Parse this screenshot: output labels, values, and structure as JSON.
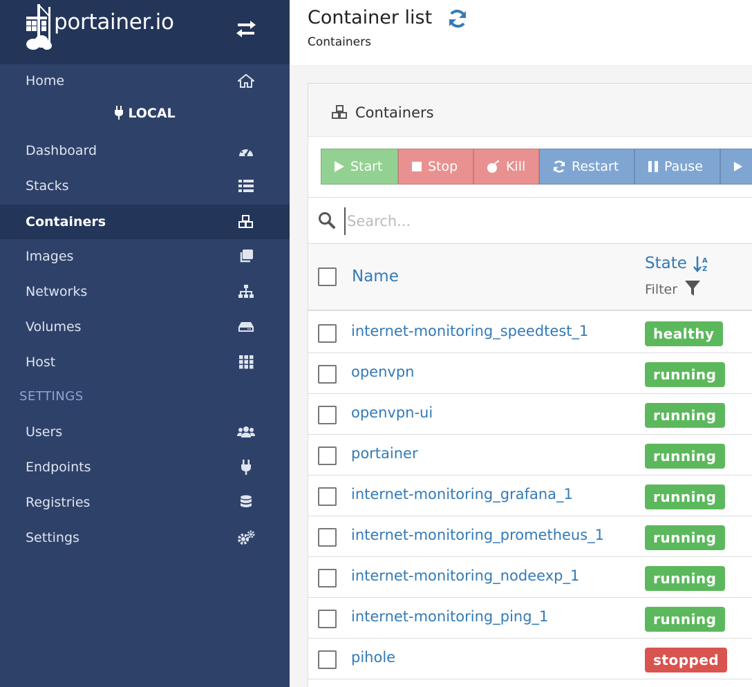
{
  "brand": {
    "logo_text": "portainer.io"
  },
  "sidebar": {
    "home": "Home",
    "endpoint": "LOCAL",
    "items": [
      {
        "label": "Dashboard",
        "icon": "tachometer-icon"
      },
      {
        "label": "Stacks",
        "icon": "th-list-icon"
      },
      {
        "label": "Containers",
        "icon": "cubes-icon",
        "active": true
      },
      {
        "label": "Images",
        "icon": "clone-icon"
      },
      {
        "label": "Networks",
        "icon": "sitemap-icon"
      },
      {
        "label": "Volumes",
        "icon": "hdd-icon"
      },
      {
        "label": "Host",
        "icon": "th-icon"
      }
    ],
    "settings_section": "SETTINGS",
    "settings_items": [
      {
        "label": "Users",
        "icon": "users-icon"
      },
      {
        "label": "Endpoints",
        "icon": "plug-icon"
      },
      {
        "label": "Registries",
        "icon": "database-icon"
      },
      {
        "label": "Settings",
        "icon": "cogs-icon"
      }
    ]
  },
  "header": {
    "title": "Container list",
    "breadcrumb": "Containers"
  },
  "panel": {
    "title": "Containers",
    "actions": {
      "start": "Start",
      "stop": "Stop",
      "kill": "Kill",
      "restart": "Restart",
      "pause": "Pause"
    },
    "search": {
      "placeholder": "Search..."
    },
    "columns": {
      "name": "Name",
      "state": "State",
      "filter": "Filter"
    },
    "rows": [
      {
        "name": "internet-monitoring_speedtest_1",
        "state": "healthy"
      },
      {
        "name": "openvpn",
        "state": "running"
      },
      {
        "name": "openvpn-ui",
        "state": "running"
      },
      {
        "name": "portainer",
        "state": "running"
      },
      {
        "name": "internet-monitoring_grafana_1",
        "state": "running"
      },
      {
        "name": "internet-monitoring_prometheus_1",
        "state": "running"
      },
      {
        "name": "internet-monitoring_nodeexp_1",
        "state": "running"
      },
      {
        "name": "internet-monitoring_ping_1",
        "state": "running"
      },
      {
        "name": "pihole",
        "state": "stopped"
      }
    ]
  },
  "colors": {
    "sidebar": "#2e4169",
    "sidebar_dark": "#24355a",
    "link": "#337ab7",
    "success": "#5cb85c",
    "danger": "#d9534f"
  }
}
